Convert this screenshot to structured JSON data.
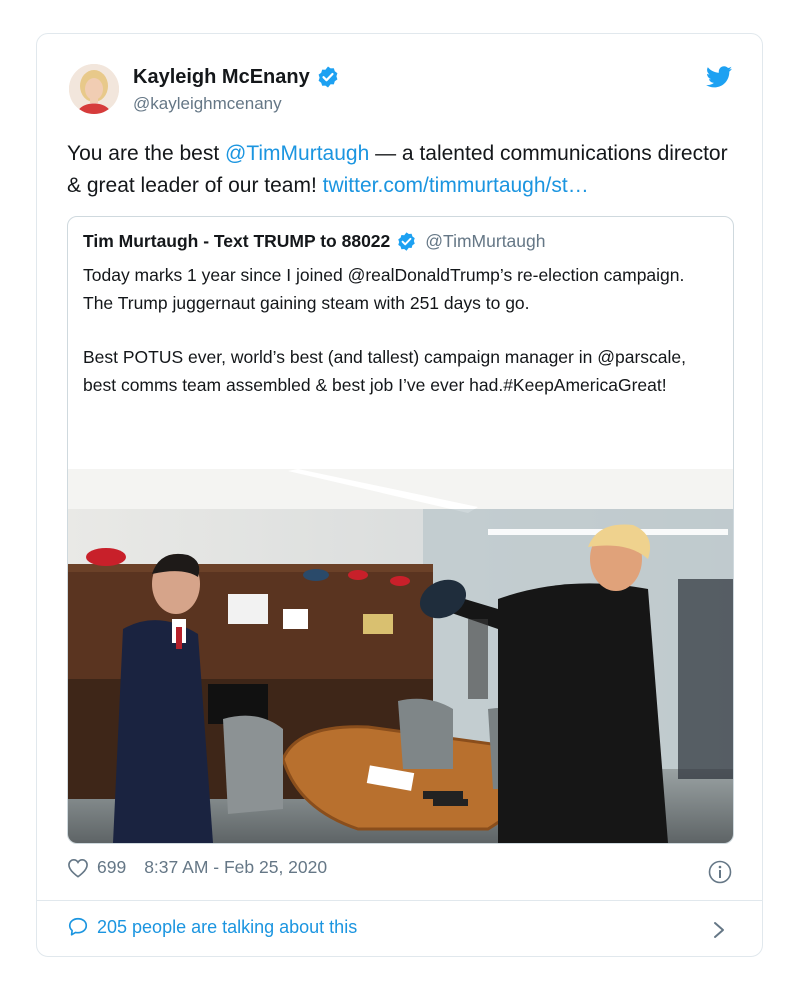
{
  "author": {
    "name": "Kayleigh McEnany",
    "handle": "@kayleighmcenany",
    "avatar_icon": "profile-photo"
  },
  "tweet": {
    "text_start": "You are the best ",
    "mention": "@TimMurtaugh",
    "text_mid": " — a talented communications director & great leader of our team! ",
    "link": "twitter.com/timmurtaugh/st…"
  },
  "quoted_tweet": {
    "name": "Tim Murtaugh - Text TRUMP to 88022",
    "handle": "@TimMurtaugh",
    "paragraph_1": "Today marks 1 year since I joined @realDonaldTrump’s re-election campaign. The Trump juggernaut gaining steam with 251 days to go.",
    "paragraph_2": "Best POTUS ever, world’s best (and tallest) campaign manager in @parscale, best comms team assembled & best job I’ve ever had.#KeepAmericaGreat!",
    "photo": "office-photo"
  },
  "footer": {
    "likes": "699",
    "timestamp": "8:37 AM - Feb 25, 2020",
    "conversation_label": "205 people are talking about this"
  },
  "colors": {
    "accent": "#1b95e0",
    "muted": "#657786",
    "border": "#e1e8ed"
  }
}
